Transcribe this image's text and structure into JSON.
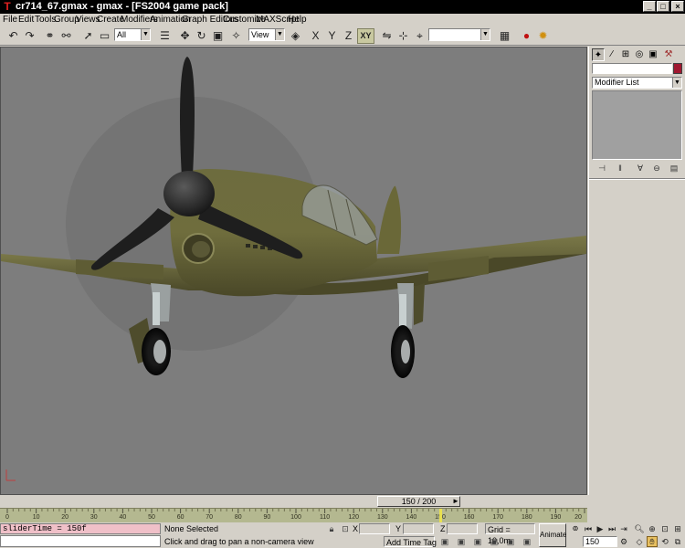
{
  "window": {
    "title": "cr714_67.gmax - gmax - [FS2004 game pack]",
    "logo_glyph": "T",
    "minimize_label": "_",
    "maximize_label": "□",
    "close_label": "×"
  },
  "menu": {
    "items": [
      "File",
      "Edit",
      "Tools",
      "Group",
      "Views",
      "Create",
      "Modifiers",
      "Animation",
      "Graph Editors",
      "Customize",
      "MAXScript",
      "Help"
    ]
  },
  "toolbar": {
    "selection_filter": "All",
    "reference_coord": "View",
    "axis_x": "X",
    "axis_y": "Y",
    "axis_z": "Z",
    "axis_xy": "XY",
    "named_selection": ""
  },
  "command_panel": {
    "modifier_list_label": "Modifier List",
    "object_color": "#a01830"
  },
  "timeline": {
    "frame_display": "150 / 200",
    "ticks": [
      "0",
      "10",
      "20",
      "30",
      "40",
      "50",
      "60",
      "70",
      "80",
      "90",
      "100",
      "110",
      "120",
      "130",
      "140",
      "150",
      "160",
      "170",
      "180",
      "190",
      "20"
    ],
    "current_frame_fraction": 0.75
  },
  "status": {
    "listener_text": "sliderTime = 150f",
    "selection_status": "None Selected",
    "prompt_text": "Click and drag to pan a non-camera view",
    "x_label": "X",
    "y_label": "Y",
    "z_label": "Z",
    "grid_label": "Grid = 10,0m",
    "add_time_tag": "Add Time Tag",
    "animate_label": "Animate",
    "current_frame": "150"
  }
}
